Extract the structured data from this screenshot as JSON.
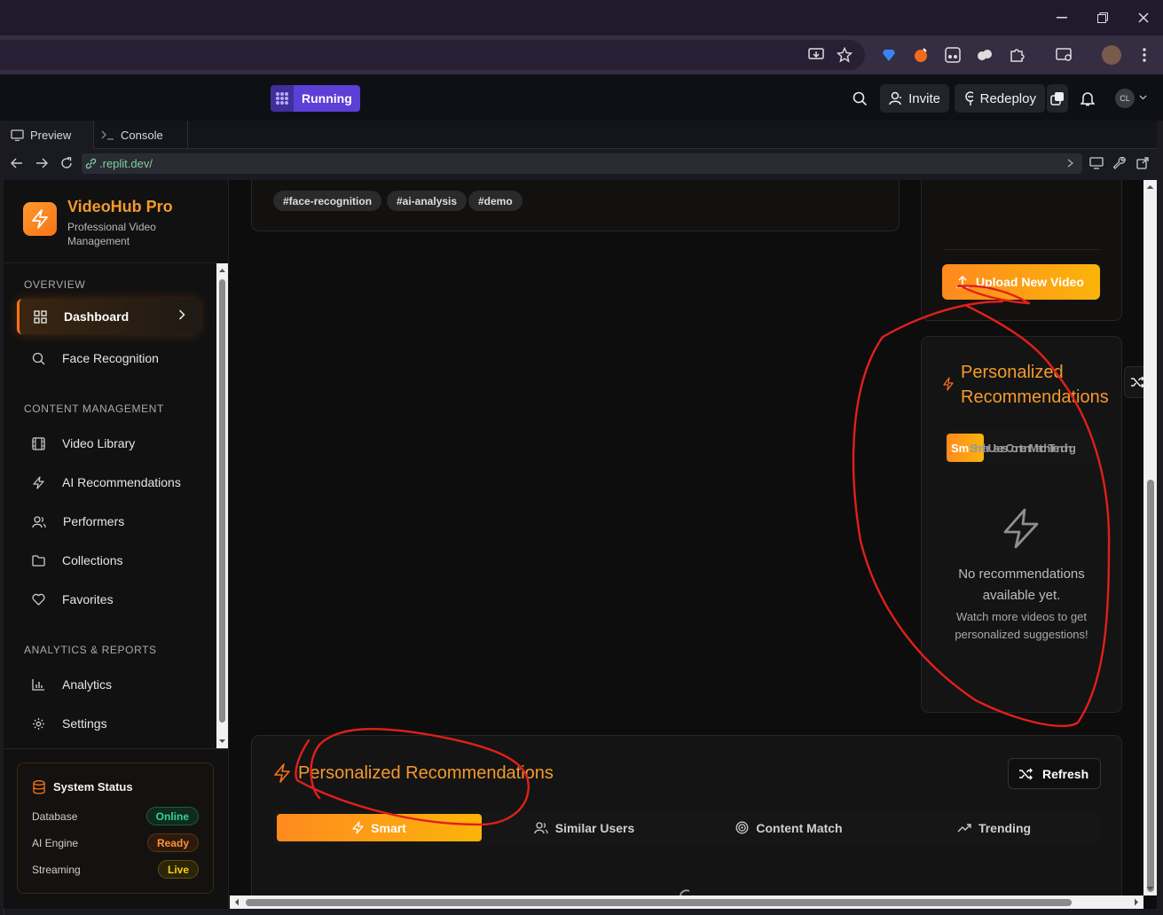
{
  "replit": {
    "status": "Running",
    "invite_label": "Invite",
    "redeploy_label": "Redeploy",
    "avatar_initials": "CL"
  },
  "panel": {
    "tabs": [
      "Preview",
      "Console"
    ],
    "url": ".replit.dev/"
  },
  "sidebar": {
    "brand_title": "VideoHub Pro",
    "brand_subtitle": "Professional Video Management",
    "sections": {
      "overview": "OVERVIEW",
      "content": "CONTENT MANAGEMENT",
      "analytics": "ANALYTICS & REPORTS"
    },
    "items": [
      {
        "label": "Dashboard",
        "icon": "grid-icon"
      },
      {
        "label": "Face Recognition",
        "icon": "search-icon"
      },
      {
        "label": "Video Library",
        "icon": "film-icon"
      },
      {
        "label": "AI Recommendations",
        "icon": "zap-icon"
      },
      {
        "label": "Performers",
        "icon": "users-icon"
      },
      {
        "label": "Collections",
        "icon": "folder-icon"
      },
      {
        "label": "Favorites",
        "icon": "heart-icon"
      },
      {
        "label": "Analytics",
        "icon": "bar-chart-icon"
      },
      {
        "label": "Settings",
        "icon": "gear-icon"
      }
    ],
    "system_status": {
      "title": "System Status",
      "rows": [
        {
          "label": "Database",
          "value": "Online",
          "color": "#34d399"
        },
        {
          "label": "AI Engine",
          "value": "Ready",
          "color": "#fb923c"
        },
        {
          "label": "Streaming",
          "value": "Live",
          "color": "#facc15"
        }
      ]
    }
  },
  "main": {
    "tags": [
      "#face-recognition",
      "#ai-analysis",
      "#demo"
    ],
    "upload_label": "Upload New Video",
    "side_rec": {
      "title": "Personalized Recommendations",
      "tabs_overlapping_text": "Smart Similar Users Content Match Trending",
      "tab_first": "Sm",
      "tab_rest": "Similar Users Content Match Trending",
      "empty_title": "No recommendations available yet.",
      "empty_sub": "Watch more videos to get personalized suggestions!"
    },
    "main_rec": {
      "title": "Personalized Recommendations",
      "refresh_label": "Refresh",
      "tabs": [
        {
          "label": "Smart",
          "icon": "zap-icon"
        },
        {
          "label": "Similar Users",
          "icon": "users-icon"
        },
        {
          "label": "Content Match",
          "icon": "target-icon"
        },
        {
          "label": "Trending",
          "icon": "trending-up-icon"
        }
      ]
    }
  },
  "colors": {
    "accent": "#f97316",
    "accent_text": "#f39a2c",
    "annotation": "#e0201a"
  }
}
